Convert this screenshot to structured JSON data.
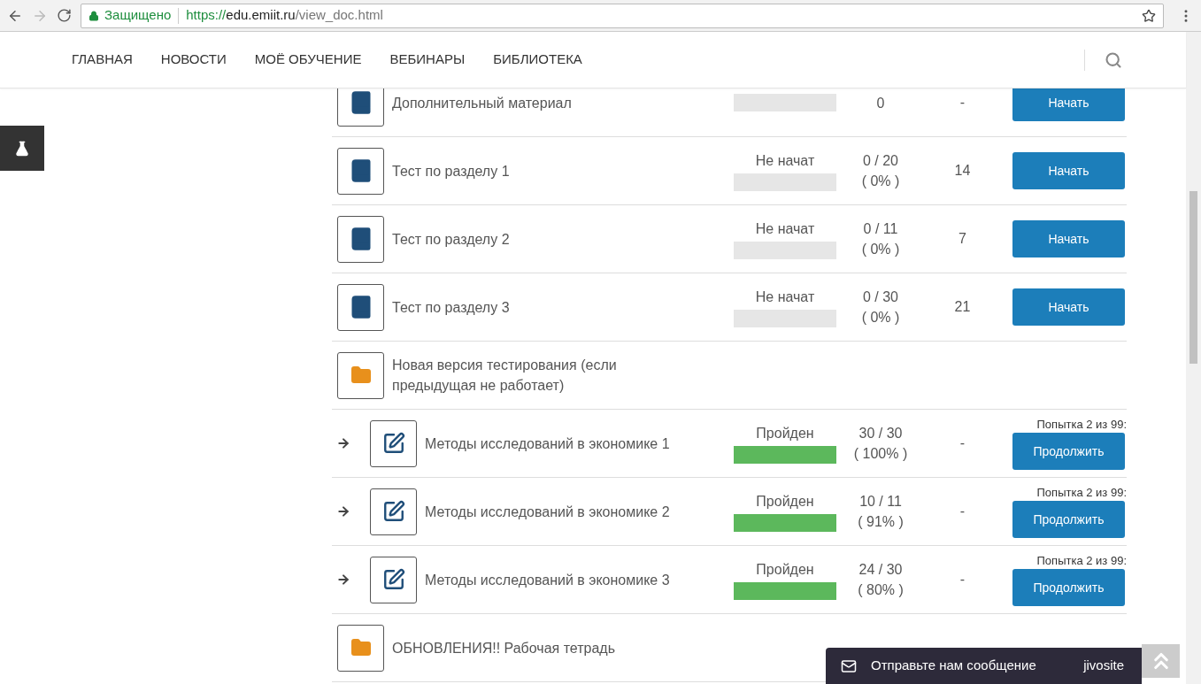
{
  "browser": {
    "security": "Защищено",
    "url_scheme": "https://",
    "url_host": "edu.emiit.ru",
    "url_path": "/view_doc.html"
  },
  "nav": [
    {
      "label": "ГЛАВНАЯ"
    },
    {
      "label": "НОВОСТИ"
    },
    {
      "label": "МОЁ ОБУЧЕНИЕ"
    },
    {
      "label": "ВЕБИНАРЫ"
    },
    {
      "label": "БИБЛИОТЕКА"
    }
  ],
  "items": [
    {
      "kind": "test",
      "title": "Дополнительный материал",
      "level": 0,
      "score": "0",
      "count": "-",
      "button": "Начать"
    },
    {
      "kind": "test",
      "title": "Тест по разделу 1",
      "status": "Не начат",
      "level": 0,
      "score": "0 / 20",
      "percent": "( 0% )",
      "count": "14",
      "button": "Начать"
    },
    {
      "kind": "test",
      "title": "Тест по разделу 2",
      "status": "Не начат",
      "level": 0,
      "score": "0 / 11",
      "percent": "( 0% )",
      "count": "7",
      "button": "Начать"
    },
    {
      "kind": "test",
      "title": "Тест по разделу 3",
      "status": "Не начат",
      "level": 0,
      "score": "0 / 30",
      "percent": "( 0% )",
      "count": "21",
      "button": "Начать"
    },
    {
      "kind": "folder",
      "title": "Новая версия тестирования (если предыдущая не работает)",
      "children": [
        {
          "kind": "quiz",
          "title": "Методы исследований в экономике 1",
          "status": "Пройден",
          "level": 1,
          "score": "30 / 30",
          "percent": "( 100% )",
          "count": "-",
          "attempt": "Попытка 2 из 99:",
          "button": "Продолжить"
        },
        {
          "kind": "quiz",
          "title": "Методы исследований в экономике 2",
          "status": "Пройден",
          "level": 1,
          "score": "10 / 11",
          "percent": "( 91% )",
          "count": "-",
          "attempt": "Попытка 2 из 99:",
          "button": "Продолжить"
        },
        {
          "kind": "quiz",
          "title": "Методы исследований в экономике 3",
          "status": "Пройден",
          "level": 1,
          "score": "24 / 30",
          "percent": "( 80% )",
          "count": "-",
          "attempt": "Попытка 2 из 99:",
          "button": "Продолжить"
        }
      ]
    },
    {
      "kind": "folder",
      "title": "ОБНОВЛЕНИЯ!! Рабочая тетрадь"
    }
  ],
  "chat": {
    "label": "Отправьте нам сообщение",
    "brand": "jivosite"
  }
}
